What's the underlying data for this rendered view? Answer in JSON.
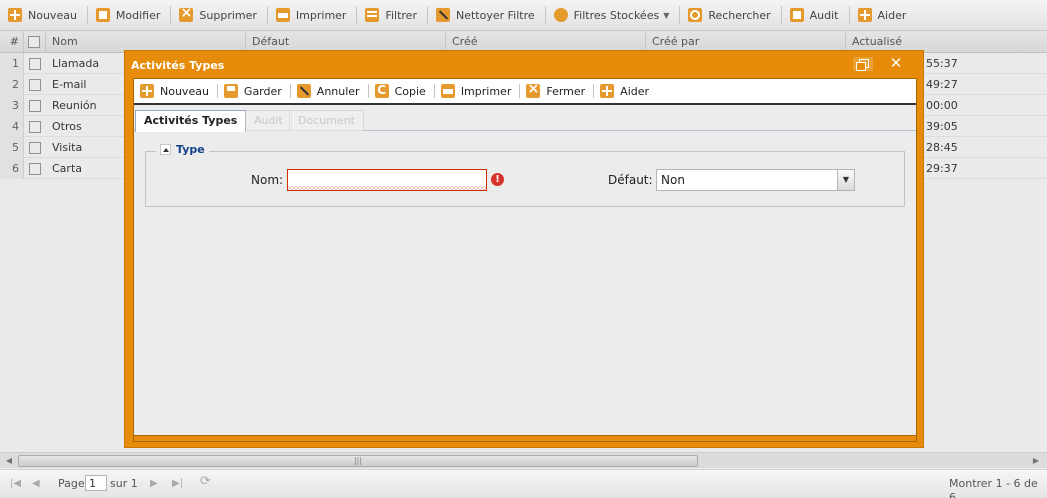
{
  "toolbar": {
    "nouveau": "Nouveau",
    "modifier": "Modifier",
    "supprimer": "Supprimer",
    "imprimer": "Imprimer",
    "filtrer": "Filtrer",
    "nettoyer": "Nettoyer Filtre",
    "filtres_stockees": "Filtres Stockées",
    "rechercher": "Rechercher",
    "audit": "Audit",
    "aider": "Aider"
  },
  "grid": {
    "columns": {
      "num": "#",
      "nom": "Nom",
      "defaut": "Défaut",
      "cree": "Créé",
      "cree_par": "Créé par",
      "actualise": "Actualisé"
    },
    "rows": [
      {
        "num": "1",
        "nom": "Llamada",
        "time": "55:37"
      },
      {
        "num": "2",
        "nom": "E-mail",
        "time": "49:27"
      },
      {
        "num": "3",
        "nom": "Reunión",
        "time": "00:00"
      },
      {
        "num": "4",
        "nom": "Otros",
        "time": "39:05"
      },
      {
        "num": "5",
        "nom": "Visita",
        "time": "28:45"
      },
      {
        "num": "6",
        "nom": "Carta",
        "time": "29:37"
      }
    ]
  },
  "pager": {
    "page_label": "Page",
    "page_value": "1",
    "of_label": "sur 1",
    "summary": "Montrer 1 - 6 de 6"
  },
  "modal": {
    "title": "Activités Types",
    "toolbar": {
      "nouveau": "Nouveau",
      "garder": "Garder",
      "annuler": "Annuler",
      "copie": "Copie",
      "imprimer": "Imprimer",
      "fermer": "Fermer",
      "aider": "Aider"
    },
    "tabs": [
      "Activités Types",
      "Audit",
      "Document"
    ],
    "fieldset_title": "Type",
    "nom_label": "Nom:",
    "nom_value": "",
    "defaut_label": "Défaut:",
    "defaut_value": "Non"
  },
  "colors": {
    "accent": "#e78c0a",
    "icon": "#e69a2d",
    "legend": "#15428b",
    "error": "#d6332a"
  }
}
